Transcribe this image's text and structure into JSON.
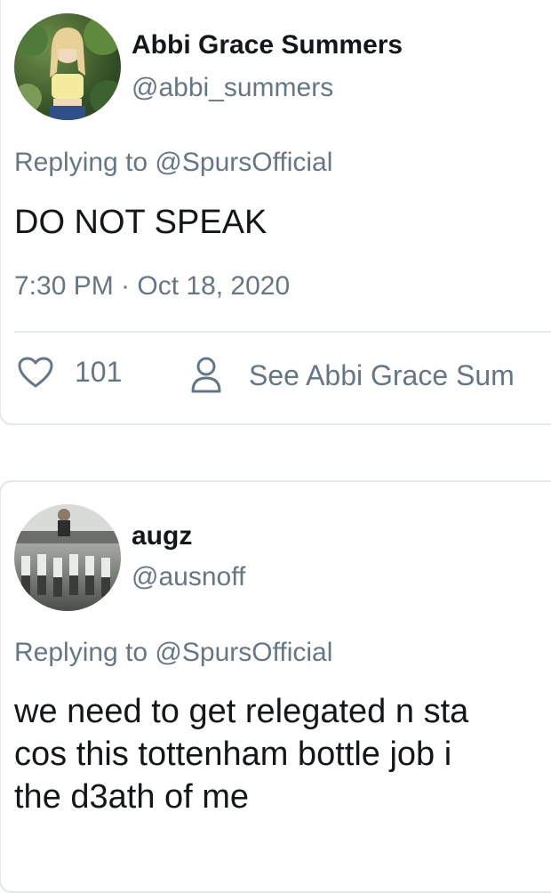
{
  "tweets": [
    {
      "name": "Abbi Grace Summers",
      "handle": "@abbi_summers",
      "replying": "Replying to @SpursOfficial",
      "text_lines": [
        "DO NOT SPEAK"
      ],
      "timestamp": "7:30 PM · Oct 18, 2020",
      "likes": "101",
      "see_label": "See Abbi Grace Sum",
      "avatar_icon": "profile-photo"
    },
    {
      "name": "augz",
      "handle": "@ausnoff",
      "replying": "Replying to @SpursOfficial",
      "text_lines": [
        "we need to get relegated n sta",
        "cos this tottenham bottle job i",
        "the d3ath of me"
      ],
      "avatar_icon": "profile-photo"
    }
  ],
  "colors": {
    "secondary_text": "#657786",
    "divider": "#e3e8ec",
    "text": "#14171a"
  }
}
